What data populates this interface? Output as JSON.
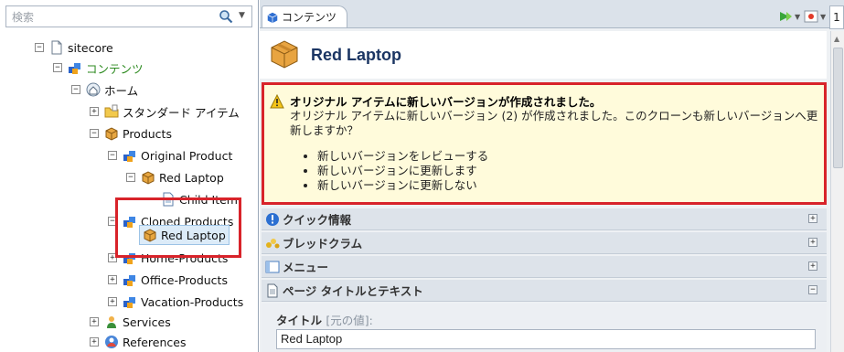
{
  "search": {
    "placeholder": "検索"
  },
  "tree": {
    "sitecore": "sitecore",
    "content": "コンテンツ",
    "home": "ホーム",
    "standard": "スタンダード アイテム",
    "products": "Products",
    "original": "Original Product",
    "red_laptop_orig": "Red Laptop",
    "child_item": "Child Item",
    "cloned": "Cloned Products",
    "red_laptop_clone": "Red Laptop",
    "home_products": "Home-Products",
    "office_products": "Office-Products",
    "vacation_products": "Vacation-Products",
    "services": "Services",
    "references": "References"
  },
  "tab": {
    "label": "コンテンツ",
    "number": "1"
  },
  "item": {
    "title": "Red Laptop"
  },
  "warning": {
    "title": "オリジナル アイテムに新しいバージョンが作成されました。",
    "body": "オリジナル アイテムに新しいバージョン (2) が作成されました。このクローンも新しいバージョンへ更新しますか？",
    "options": [
      "新しいバージョンをレビューする",
      "新しいバージョンに更新します",
      "新しいバージョンに更新しない"
    ]
  },
  "sections": {
    "quick_info": "クイック情報",
    "breadcrumb": "ブレッドクラム",
    "menu": "メニュー",
    "page_title": "ページ タイトルとテキスト"
  },
  "field": {
    "label": "タイトル",
    "original": "[元の値]:",
    "value": "Red Laptop"
  },
  "colors": {
    "highlight_border": "#d8232a",
    "warning_bg": "#fffbdb",
    "title": "#1b3563"
  },
  "icons": [
    "search-icon",
    "sitecore-icon",
    "content-icon",
    "home-icon",
    "folder-icon",
    "product-box-icon",
    "child-item-icon",
    "services-icon",
    "references-icon",
    "warning-icon",
    "info-icon",
    "breadcrumb-icon",
    "menu-icon",
    "page-icon"
  ]
}
